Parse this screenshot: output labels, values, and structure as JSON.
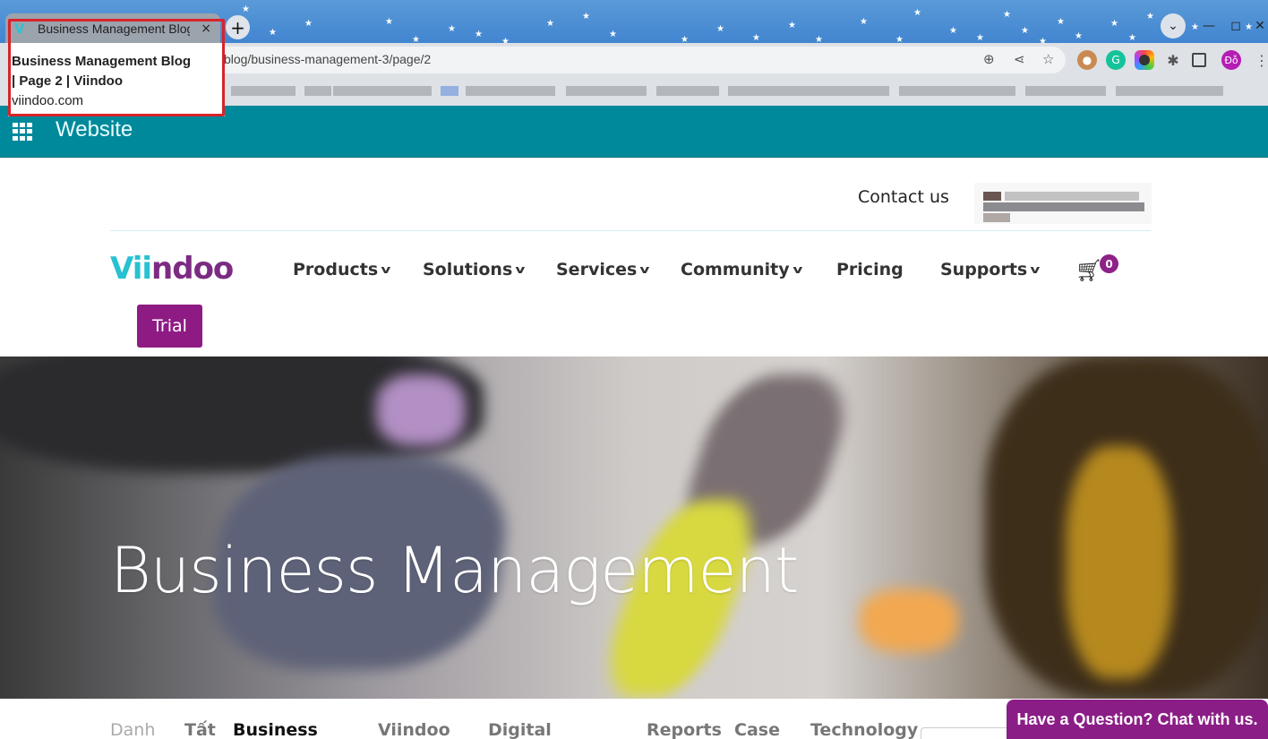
{
  "browser": {
    "tab_title": "Business Management Blog | Page 2 | Viindoo",
    "tab_favicon": "viindoo-v-icon",
    "close_tab_glyph": "×",
    "new_tab_glyph": "+",
    "url": "blog/business-management-3/page/2",
    "profile_initials": "Đỗ",
    "hovercard": {
      "title_line1": "Business Management Blog",
      "title_line2": "| Page 2 | Viindoo",
      "domain": "viindoo.com"
    },
    "icons": [
      "zoom-icon",
      "share-icon",
      "bookmark-star-icon",
      "monkey-extension-icon",
      "grammarly-extension-icon",
      "color-extension-icon",
      "extensions-puzzle-icon",
      "side-panel-icon",
      "profile-avatar",
      "menu-kebab-icon"
    ]
  },
  "odoo_bar": {
    "label": "Website"
  },
  "header": {
    "contact_label": "Contact us",
    "logo_part1": "Vii",
    "logo_part2": "ndoo",
    "nav": [
      {
        "label": "Products",
        "dropdown": true
      },
      {
        "label": "Solutions",
        "dropdown": true
      },
      {
        "label": "Services",
        "dropdown": true
      },
      {
        "label": "Community",
        "dropdown": true
      },
      {
        "label": "Pricing",
        "dropdown": false
      },
      {
        "label": "Supports",
        "dropdown": true
      }
    ],
    "cart_count": "0",
    "trial_label": "Trial",
    "accent_color": "#8e1b84",
    "brand_teal": "#27c1d1"
  },
  "hero": {
    "title": "Business Management"
  },
  "categories": {
    "items": [
      "Danh",
      "Tất",
      "Business",
      "Viindoo",
      "Digital",
      "Reports",
      "Case",
      "Technology"
    ],
    "active": "Business"
  },
  "chat": {
    "label": "Have a Question? Chat with us."
  }
}
